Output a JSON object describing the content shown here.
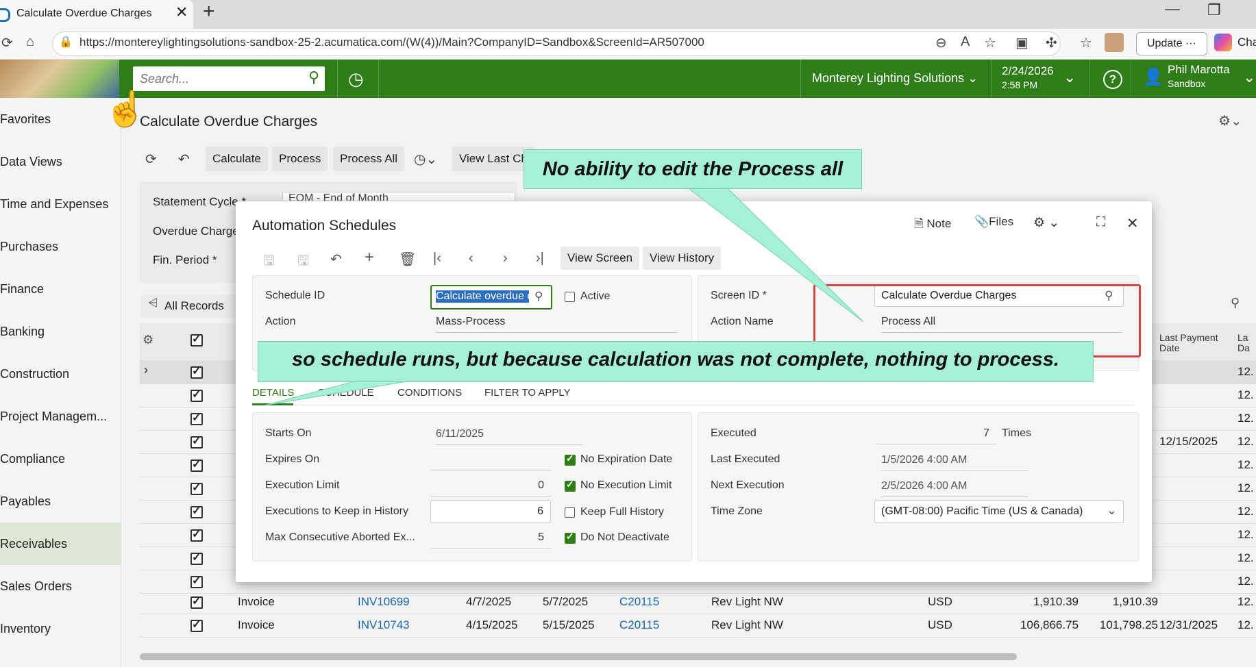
{
  "browser": {
    "tab_title": "Calculate Overdue Charges",
    "tab_close": "✕",
    "new_tab": "+",
    "url": "https://montereylightingsolutions-sandbox-25-2.acumatica.com/(W(4))/Main?CompanyID=Sandbox&ScreenId=AR507000",
    "update_label": "Update",
    "copilot_label": "Cha"
  },
  "header": {
    "search_placeholder": "Search...",
    "company": "Monterey Lighting Solutions",
    "date": "2/24/2026",
    "time": "2:58 PM",
    "user_name": "Phil Marotta",
    "user_tenant": "Sandbox"
  },
  "sidebar": {
    "items": [
      {
        "label": "Favorites"
      },
      {
        "label": "Data Views"
      },
      {
        "label": "Time and Expenses"
      },
      {
        "label": "Purchases"
      },
      {
        "label": "Finance"
      },
      {
        "label": "Banking"
      },
      {
        "label": "Construction"
      },
      {
        "label": "Project Managem..."
      },
      {
        "label": "Compliance"
      },
      {
        "label": "Payables"
      },
      {
        "label": "Receivables"
      },
      {
        "label": "Sales Orders"
      },
      {
        "label": "Inventory"
      }
    ]
  },
  "page": {
    "title": "Calculate Overdue Charges",
    "toolbar": {
      "calculate": "Calculate",
      "process": "Process",
      "process_all": "Process All",
      "view_last": "View Last Ch"
    },
    "filters": {
      "statement_cycle_label": "Statement Cycle *",
      "statement_cycle_value": "EOM - End of Month",
      "overdue_charge_label": "Overdue Charge",
      "fin_period_label": "Fin. Period *"
    },
    "all_records": "All Records",
    "grid_header": {
      "last_payment_date": "Last Payment Date",
      "la": "La Da"
    },
    "rows": [
      {
        "type": "Invoice",
        "ref": "INV10699",
        "date": "4/7/2025",
        "due": "5/7/2025",
        "customer": "C20115",
        "name": "Rev Light NW",
        "currency": "USD",
        "amount": "1,910.39",
        "balance": "1,910.39",
        "last_payment": "",
        "last": "12."
      },
      {
        "type": "Invoice",
        "ref": "INV10743",
        "date": "4/15/2025",
        "due": "5/15/2025",
        "customer": "C20115",
        "name": "Rev Light NW",
        "currency": "USD",
        "amount": "106,866.75",
        "balance": "101,798.25",
        "last_payment": "12/31/2025",
        "last": "12."
      }
    ],
    "hidden_rows_last_payment": "12/15/2025",
    "row_suffix": "12."
  },
  "dialog": {
    "title": "Automation Schedules",
    "note": "Note",
    "files": "Files",
    "view_screen": "View Screen",
    "view_history": "View History",
    "schedule_id_label": "Schedule ID",
    "schedule_id_value": "Calculate overdue c",
    "active_label": "Active",
    "action_label": "Action",
    "action_value": "Mass-Process",
    "screen_id_label": "Screen ID *",
    "screen_id_value": "Calculate Overdue Charges",
    "action_name_label": "Action Name",
    "action_name_value": "Process All",
    "tabs": [
      "DETAILS",
      "SCHEDULE",
      "CONDITIONS",
      "FILTER TO APPLY"
    ],
    "details": {
      "starts_on_label": "Starts On",
      "starts_on_value": "6/11/2025",
      "expires_on_label": "Expires On",
      "no_expiration_label": "No Expiration Date",
      "execution_limit_label": "Execution Limit",
      "execution_limit_value": "0",
      "no_execution_limit_label": "No Execution Limit",
      "keep_history_label": "Executions to Keep in History",
      "keep_history_value": "6",
      "keep_full_history_label": "Keep Full History",
      "max_aborted_label": "Max Consecutive Aborted Ex...",
      "max_aborted_value": "5",
      "do_not_deactivate_label": "Do Not Deactivate",
      "executed_label": "Executed",
      "executed_value": "7",
      "times_label": "Times",
      "last_executed_label": "Last Executed",
      "last_executed_value": "1/5/2026 4:00 AM",
      "next_execution_label": "Next Execution",
      "next_execution_value": "2/5/2026 4:00 AM",
      "time_zone_label": "Time Zone",
      "time_zone_value": "(GMT-08:00) Pacific Time (US & Canada)"
    }
  },
  "annotations": {
    "callout1": "No ability to edit the Process all",
    "callout2": "so schedule runs, but because calculation was not complete, nothing to process.",
    "highlight_color": "#d64545",
    "callout_color": "#a6f0d8"
  },
  "colors": {
    "header_green": "#2e7d18",
    "link_blue": "#1a65b0"
  }
}
